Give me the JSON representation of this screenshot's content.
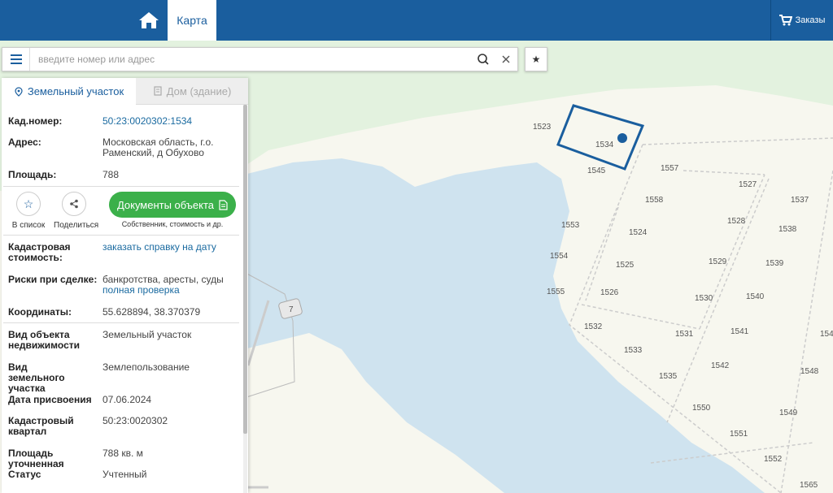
{
  "header": {
    "map_tab": "Карта",
    "orders_label": "Заказы",
    "home_icon": "home-icon",
    "cart_icon": "cart-icon"
  },
  "search": {
    "placeholder": "введите номер или адрес",
    "value": ""
  },
  "panel": {
    "tabs": [
      {
        "label": "Земельный участок",
        "icon": "pin-icon",
        "active": true
      },
      {
        "label": "Дом (здание)",
        "icon": "building-icon",
        "active": false
      }
    ],
    "cad_number": {
      "label": "Кад.номер:",
      "value": "50:23:0020302:1534"
    },
    "address": {
      "label": "Адрес:",
      "value": "Московская область, г.о. Раменский, д Обухово"
    },
    "area": {
      "label": "Площадь:",
      "value": "788"
    },
    "actions": {
      "to_list": "В список",
      "share": "Поделиться",
      "documents": "Документы объекта",
      "documents_sub": "Собственник, стоимость и др."
    },
    "cad_value": {
      "label": "Кадастровая стоимость:",
      "value": "заказать справку на дату"
    },
    "risks": {
      "label": "Риски при сделке:",
      "value": "банкротства, аресты, суды",
      "link": "полная проверка"
    },
    "coords": {
      "label": "Координаты:",
      "value": "55.628894, 38.370379"
    },
    "object_type": {
      "label": "Вид объекта недвижимости",
      "value": "Земельный участок"
    },
    "land_type": {
      "label": "Вид земельного участка",
      "value": "Землепользование"
    },
    "assigned_date": {
      "label": "Дата присвоения",
      "value": "07.06.2024"
    },
    "cad_quarter": {
      "label": "Кадастровый квартал",
      "value": "50:23:0020302"
    },
    "area_precise": {
      "label": "Площадь уточненная",
      "value": "788 кв. м"
    },
    "status": {
      "label": "Статус",
      "value": "Учтенный"
    }
  },
  "map": {
    "colors": {
      "water": "#cfe3ef",
      "green": "#e3f2df",
      "ground": "#f7f7ef",
      "parcel": "#1a5e9e"
    },
    "road_number": "7",
    "plots": [
      {
        "id": "1523",
        "label": "1523"
      },
      {
        "id": "1534",
        "label": "1534"
      },
      {
        "id": "1545",
        "label": "1545"
      },
      {
        "id": "1557",
        "label": "1557"
      },
      {
        "id": "1527",
        "label": "1527"
      },
      {
        "id": "1537",
        "label": "1537"
      },
      {
        "id": "1558",
        "label": "1558"
      },
      {
        "id": "1553",
        "label": "1553"
      },
      {
        "id": "1524",
        "label": "1524"
      },
      {
        "id": "1528",
        "label": "1528"
      },
      {
        "id": "1538",
        "label": "1538"
      },
      {
        "id": "1554",
        "label": "1554"
      },
      {
        "id": "1525",
        "label": "1525"
      },
      {
        "id": "1529",
        "label": "1529"
      },
      {
        "id": "1539",
        "label": "1539"
      },
      {
        "id": "1555",
        "label": "1555"
      },
      {
        "id": "1526",
        "label": "1526"
      },
      {
        "id": "1530",
        "label": "1530"
      },
      {
        "id": "1540",
        "label": "1540"
      },
      {
        "id": "1532",
        "label": "1532"
      },
      {
        "id": "1531",
        "label": "1531"
      },
      {
        "id": "1541",
        "label": "1541"
      },
      {
        "id": "154",
        "label": "154"
      },
      {
        "id": "1533",
        "label": "1533"
      },
      {
        "id": "1542",
        "label": "1542"
      },
      {
        "id": "1535",
        "label": "1535"
      },
      {
        "id": "1548",
        "label": "1548"
      },
      {
        "id": "1550",
        "label": "1550"
      },
      {
        "id": "1549",
        "label": "1549"
      },
      {
        "id": "1551",
        "label": "1551"
      },
      {
        "id": "1552",
        "label": "1552"
      },
      {
        "id": "1565",
        "label": "1565"
      }
    ]
  }
}
